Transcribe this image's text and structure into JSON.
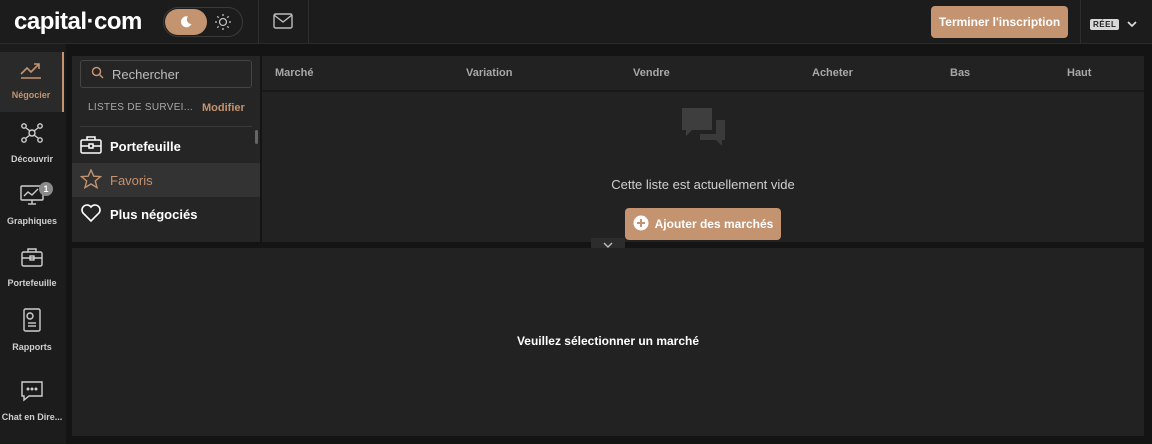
{
  "app": {
    "logo": "capital·com"
  },
  "header": {
    "finish_label": "Terminer l'inscription",
    "account_badge": "RÉEL"
  },
  "sidebar": {
    "items": [
      {
        "label": "Négocier",
        "icon": "trending-up-icon"
      },
      {
        "label": "Découvrir",
        "icon": "network-icon"
      },
      {
        "label": "Graphiques",
        "icon": "chart-monitor-icon",
        "badge": "1"
      },
      {
        "label": "Portefeuille",
        "icon": "briefcase-icon"
      },
      {
        "label": "Rapports",
        "icon": "report-icon"
      },
      {
        "label": "Chat en Dire...",
        "icon": "chat-icon"
      }
    ]
  },
  "watchlist": {
    "search_placeholder": "Rechercher",
    "header": "LISTES DE SURVEI...",
    "edit_label": "Modifier",
    "items": [
      {
        "label": "Portefeuille",
        "icon": "briefcase-icon"
      },
      {
        "label": "Favoris",
        "icon": "star-icon"
      },
      {
        "label": "Plus négociés",
        "icon": "heart-icon"
      }
    ]
  },
  "market_table": {
    "columns": [
      "Marché",
      "Variation",
      "Vendre",
      "Acheter",
      "Bas",
      "Haut"
    ],
    "empty_text": "Cette liste est actuellement vide",
    "add_button": "Ajouter des marchés"
  },
  "detail_panel": {
    "message": "Veuillez sélectionner un marché"
  },
  "colors": {
    "accent": "#c49370",
    "background": "#141414",
    "panel": "#222222"
  }
}
